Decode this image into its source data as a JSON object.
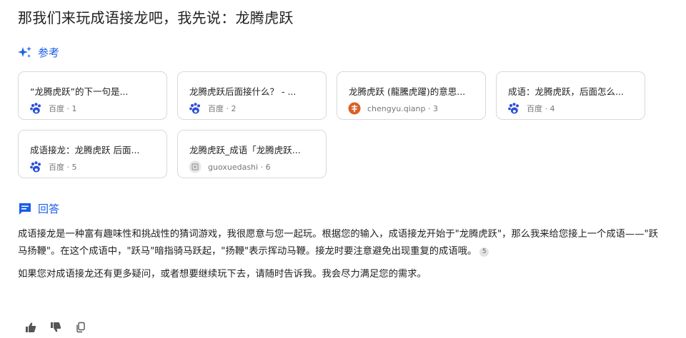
{
  "question": "那我们来玩成语接龙吧，我先说：龙腾虎跃",
  "references": {
    "title": "参考",
    "icon": "sparkle-icon",
    "accent": "#1a5ee8",
    "items": [
      {
        "title": "“龙腾虎跃”的下一句是...",
        "source": "百度 · 1",
        "icon": "baidu-paw-icon"
      },
      {
        "title": "龙腾虎跃后面接什么？ - ...",
        "source": "百度 · 2",
        "icon": "baidu-paw-icon"
      },
      {
        "title": "龙腾虎跃 (龍騰虎躍)的意思...",
        "source": "chengyu.qianp · 3",
        "icon": "qianp-logo-icon"
      },
      {
        "title": "成语：龙腾虎跃，后面怎么...",
        "source": "百度 · 4",
        "icon": "baidu-paw-icon"
      },
      {
        "title": "成语接龙：龙腾虎跃 后面...",
        "source": "百度 · 5",
        "icon": "baidu-paw-icon"
      },
      {
        "title": "龙腾虎跃_成语「龙腾虎跃...",
        "source": "guoxuedashi · 6",
        "icon": "guoxuedashi-logo-icon"
      }
    ]
  },
  "answer": {
    "title": "回答",
    "icon": "answer-chat-icon",
    "paragraph1": "成语接龙是一种富有趣味性和挑战性的猜词游戏，我很愿意与您一起玩。根据您的输入，成语接龙开始于\"龙腾虎跃\"，那么我来给您接上一个成语——\"跃马扬鞭\"。在这个成语中，\"跃马\"暗指骑马跃起，\"扬鞭\"表示挥动马鞭。接龙时要注意避免出现重复的成语哦。",
    "citation": "5",
    "paragraph2": "如果您对成语接龙还有更多疑问，或者想要继续玩下去，请随时告诉我。我会尽力满足您的需求。"
  },
  "actions": [
    "thumbs-up-icon",
    "thumbs-down-icon",
    "copy-icon"
  ]
}
